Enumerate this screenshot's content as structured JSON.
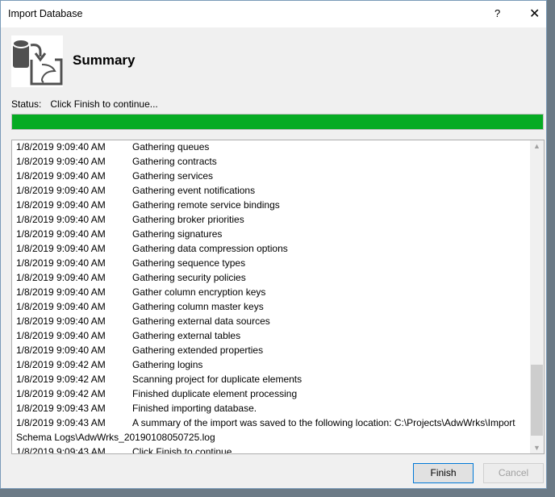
{
  "window": {
    "title": "Import Database",
    "help": "?",
    "close": "✕"
  },
  "header": {
    "title": "Summary",
    "icon": "database-import-icon"
  },
  "status": {
    "label": "Status:",
    "value": "Click Finish to continue...",
    "progress_percent": 100,
    "progress_color": "#06ab23"
  },
  "log": [
    {
      "ts": "1/8/2019 9:09:40 AM",
      "msg": "Gathering queues"
    },
    {
      "ts": "1/8/2019 9:09:40 AM",
      "msg": "Gathering contracts"
    },
    {
      "ts": "1/8/2019 9:09:40 AM",
      "msg": "Gathering services"
    },
    {
      "ts": "1/8/2019 9:09:40 AM",
      "msg": "Gathering event notifications"
    },
    {
      "ts": "1/8/2019 9:09:40 AM",
      "msg": "Gathering remote service bindings"
    },
    {
      "ts": "1/8/2019 9:09:40 AM",
      "msg": "Gathering broker priorities"
    },
    {
      "ts": "1/8/2019 9:09:40 AM",
      "msg": "Gathering signatures"
    },
    {
      "ts": "1/8/2019 9:09:40 AM",
      "msg": "Gathering data compression options"
    },
    {
      "ts": "1/8/2019 9:09:40 AM",
      "msg": "Gathering sequence types"
    },
    {
      "ts": "1/8/2019 9:09:40 AM",
      "msg": "Gathering security policies"
    },
    {
      "ts": "1/8/2019 9:09:40 AM",
      "msg": "Gather column encryption keys"
    },
    {
      "ts": "1/8/2019 9:09:40 AM",
      "msg": "Gathering column master keys"
    },
    {
      "ts": "1/8/2019 9:09:40 AM",
      "msg": "Gathering external data sources"
    },
    {
      "ts": "1/8/2019 9:09:40 AM",
      "msg": "Gathering external tables"
    },
    {
      "ts": "1/8/2019 9:09:40 AM",
      "msg": "Gathering extended properties"
    },
    {
      "ts": "1/8/2019 9:09:42 AM",
      "msg": "Gathering logins"
    },
    {
      "ts": "1/8/2019 9:09:42 AM",
      "msg": "Scanning project for duplicate elements"
    },
    {
      "ts": "1/8/2019 9:09:42 AM",
      "msg": "Finished duplicate element processing"
    },
    {
      "ts": "1/8/2019 9:09:43 AM",
      "msg": "Finished importing database."
    },
    {
      "ts": "1/8/2019 9:09:43 AM",
      "msg": "A summary of the import was saved to the following location: C:\\Projects\\AdwWrks\\Import Schema Logs\\AdwWrks_20190108050725.log"
    },
    {
      "ts": "1/8/2019 9:09:43 AM",
      "msg": "Click Finish to continue..."
    }
  ],
  "buttons": {
    "finish": "Finish",
    "cancel": "Cancel"
  }
}
